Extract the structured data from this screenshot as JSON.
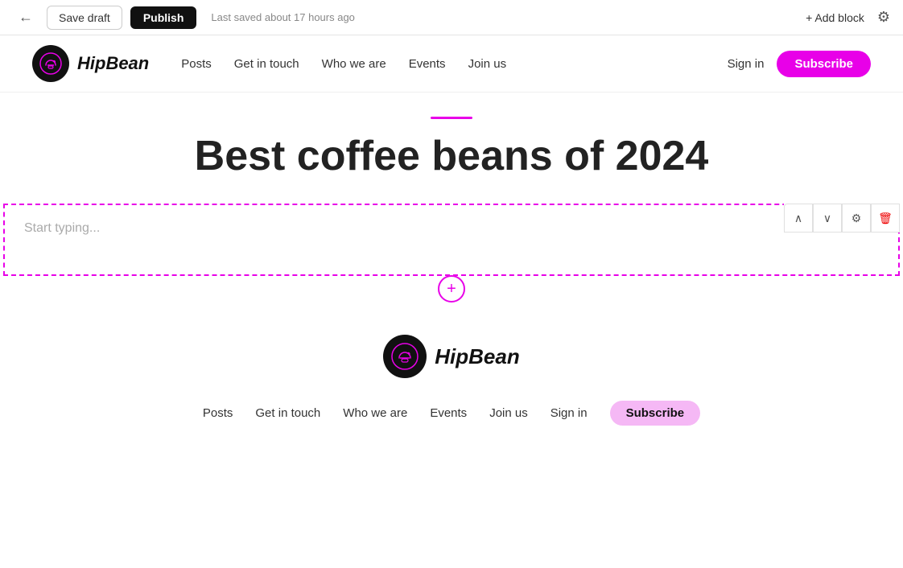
{
  "toolbar": {
    "back_label": "←",
    "save_draft_label": "Save draft",
    "publish_label": "Publish",
    "status_text": "Last saved about 17 hours ago",
    "add_block_label": "+ Add block",
    "gear_icon": "⚙"
  },
  "site_header": {
    "logo_text": "HipBean",
    "nav": [
      {
        "label": "Posts",
        "href": "#"
      },
      {
        "label": "Get in touch",
        "href": "#"
      },
      {
        "label": "Who we are",
        "href": "#"
      },
      {
        "label": "Events",
        "href": "#"
      },
      {
        "label": "Join us",
        "href": "#"
      }
    ],
    "sign_in_label": "Sign in",
    "subscribe_label": "Subscribe"
  },
  "article": {
    "title": "Best coffee beans of 2024",
    "content_placeholder": "Start typing..."
  },
  "footer": {
    "logo_text": "HipBean",
    "nav": [
      {
        "label": "Posts"
      },
      {
        "label": "Get in touch"
      },
      {
        "label": "Who we are"
      },
      {
        "label": "Events"
      },
      {
        "label": "Join us"
      },
      {
        "label": "Sign in"
      }
    ],
    "subscribe_label": "Subscribe"
  },
  "block_controls": {
    "up_icon": "∧",
    "down_icon": "∨",
    "settings_icon": "⚙",
    "delete_icon": "🗑"
  },
  "add_block_circle": "+",
  "colors": {
    "accent": "#e800e8",
    "dark": "#111111"
  }
}
